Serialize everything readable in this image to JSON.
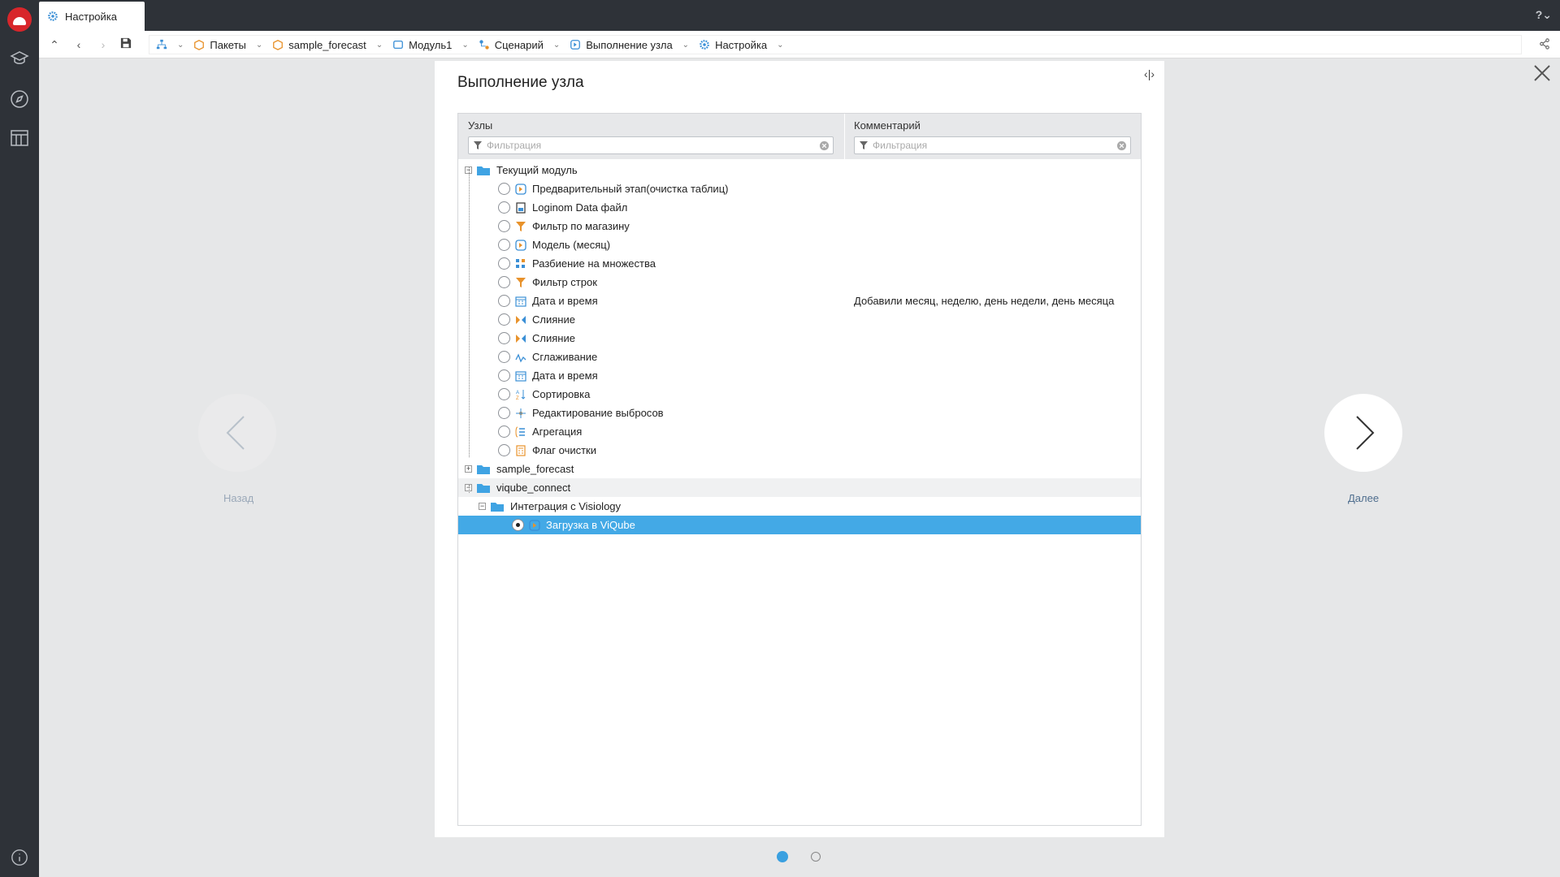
{
  "tab": {
    "title": "Настройка"
  },
  "breadcrumbs": [
    {
      "label": "",
      "icon": "hierarchy-icon"
    },
    {
      "label": "Пакеты",
      "icon": "package-icon"
    },
    {
      "label": "sample_forecast",
      "icon": "package-icon"
    },
    {
      "label": "Модуль1",
      "icon": "module-icon"
    },
    {
      "label": "Сценарий",
      "icon": "scenario-icon"
    },
    {
      "label": "Выполнение узла",
      "icon": "node-exec-icon"
    },
    {
      "label": "Настройка",
      "icon": "gear-icon"
    }
  ],
  "panel": {
    "title": "Выполнение узла",
    "columns": {
      "nodes": "Узлы",
      "comment": "Комментарий"
    },
    "filter_placeholder": "Фильтрация"
  },
  "tree": [
    {
      "label": "Текущий модуль",
      "kind": "folder",
      "expanded": true
    },
    {
      "label": "Предварительный этап(очистка таблиц)",
      "kind": "node",
      "icon": "submodel-icon",
      "comment": ""
    },
    {
      "label": "Loginom Data файл",
      "kind": "node",
      "icon": "data-file-icon",
      "comment": ""
    },
    {
      "label": "Фильтр по магазину",
      "kind": "node",
      "icon": "filter-icon",
      "comment": ""
    },
    {
      "label": "Модель (месяц)",
      "kind": "node",
      "icon": "submodel-icon",
      "comment": ""
    },
    {
      "label": "Разбиение на множества",
      "kind": "node",
      "icon": "partition-icon",
      "comment": ""
    },
    {
      "label": "Фильтр строк",
      "kind": "node",
      "icon": "filter-icon",
      "comment": ""
    },
    {
      "label": "Дата и время",
      "kind": "node",
      "icon": "calendar-icon",
      "comment": "Добавили месяц, неделю, день недели, день месяца"
    },
    {
      "label": "Слияние",
      "kind": "node",
      "icon": "merge-icon",
      "comment": ""
    },
    {
      "label": "Слияние",
      "kind": "node",
      "icon": "merge-icon",
      "comment": ""
    },
    {
      "label": "Сглаживание",
      "kind": "node",
      "icon": "smoothing-icon",
      "comment": ""
    },
    {
      "label": "Дата и время",
      "kind": "node",
      "icon": "calendar-icon",
      "comment": ""
    },
    {
      "label": "Сортировка",
      "kind": "node",
      "icon": "sort-icon",
      "comment": ""
    },
    {
      "label": "Редактирование выбросов",
      "kind": "node",
      "icon": "outliers-icon",
      "comment": ""
    },
    {
      "label": "Агрегация",
      "kind": "node",
      "icon": "aggregation-icon",
      "comment": ""
    },
    {
      "label": "Флаг очистки",
      "kind": "node",
      "icon": "calculator-icon",
      "comment": ""
    },
    {
      "label": "sample_forecast",
      "kind": "folder",
      "expanded": false
    },
    {
      "label": "viqube_connect",
      "kind": "folder",
      "expanded": true
    },
    {
      "label": "Интеграция с Visiology",
      "kind": "folder",
      "expanded": true
    },
    {
      "label": "Загрузка в ViQube",
      "kind": "node",
      "icon": "submodel-icon",
      "comment": "",
      "selected": true
    }
  ],
  "navigation": {
    "prev": "Назад",
    "next": "Далее"
  },
  "pager": {
    "pages": 2,
    "current": 1
  },
  "colors": {
    "accent": "#43a9e6",
    "sidebar": "#2e3238",
    "logo": "#d8262b"
  }
}
